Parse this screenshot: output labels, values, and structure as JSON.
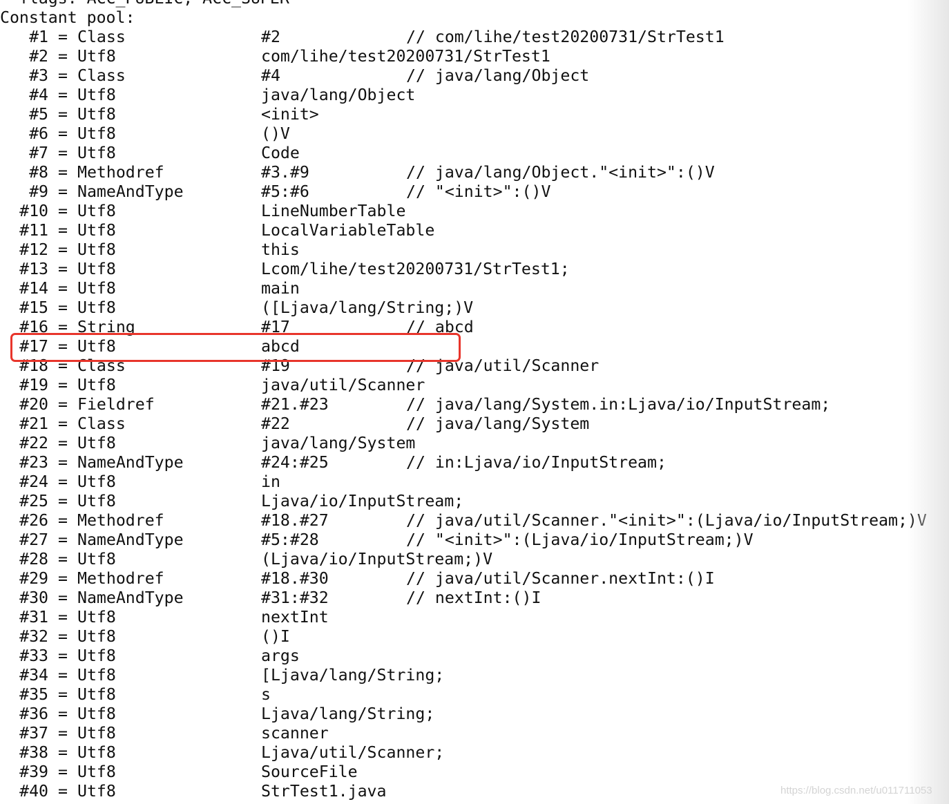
{
  "header_lines": [
    "  flags: ACC_PUBLIC, ACC_SUPER",
    "Constant pool:"
  ],
  "entries": [
    [
      "#1",
      "Class",
      "#2",
      "// com/lihe/test20200731/StrTest1"
    ],
    [
      "#2",
      "Utf8",
      "com/lihe/test20200731/StrTest1",
      ""
    ],
    [
      "#3",
      "Class",
      "#4",
      "// java/lang/Object"
    ],
    [
      "#4",
      "Utf8",
      "java/lang/Object",
      ""
    ],
    [
      "#5",
      "Utf8",
      "<init>",
      ""
    ],
    [
      "#6",
      "Utf8",
      "()V",
      ""
    ],
    [
      "#7",
      "Utf8",
      "Code",
      ""
    ],
    [
      "#8",
      "Methodref",
      "#3.#9",
      "// java/lang/Object.\"<init>\":()V"
    ],
    [
      "#9",
      "NameAndType",
      "#5:#6",
      "// \"<init>\":()V"
    ],
    [
      "#10",
      "Utf8",
      "LineNumberTable",
      ""
    ],
    [
      "#11",
      "Utf8",
      "LocalVariableTable",
      ""
    ],
    [
      "#12",
      "Utf8",
      "this",
      ""
    ],
    [
      "#13",
      "Utf8",
      "Lcom/lihe/test20200731/StrTest1;",
      ""
    ],
    [
      "#14",
      "Utf8",
      "main",
      ""
    ],
    [
      "#15",
      "Utf8",
      "([Ljava/lang/String;)V",
      ""
    ],
    [
      "#16",
      "String",
      "#17",
      "// abcd"
    ],
    [
      "#17",
      "Utf8",
      "abcd",
      ""
    ],
    [
      "#18",
      "Class",
      "#19",
      "// java/util/Scanner"
    ],
    [
      "#19",
      "Utf8",
      "java/util/Scanner",
      ""
    ],
    [
      "#20",
      "Fieldref",
      "#21.#23",
      "// java/lang/System.in:Ljava/io/InputStream;"
    ],
    [
      "#21",
      "Class",
      "#22",
      "// java/lang/System"
    ],
    [
      "#22",
      "Utf8",
      "java/lang/System",
      ""
    ],
    [
      "#23",
      "NameAndType",
      "#24:#25",
      "// in:Ljava/io/InputStream;"
    ],
    [
      "#24",
      "Utf8",
      "in",
      ""
    ],
    [
      "#25",
      "Utf8",
      "Ljava/io/InputStream;",
      ""
    ],
    [
      "#26",
      "Methodref",
      "#18.#27",
      "// java/util/Scanner.\"<init>\":(Ljava/io/InputStream;)V"
    ],
    [
      "#27",
      "NameAndType",
      "#5:#28",
      "// \"<init>\":(Ljava/io/InputStream;)V"
    ],
    [
      "#28",
      "Utf8",
      "(Ljava/io/InputStream;)V",
      ""
    ],
    [
      "#29",
      "Methodref",
      "#18.#30",
      "// java/util/Scanner.nextInt:()I"
    ],
    [
      "#30",
      "NameAndType",
      "#31:#32",
      "// nextInt:()I"
    ],
    [
      "#31",
      "Utf8",
      "nextInt",
      ""
    ],
    [
      "#32",
      "Utf8",
      "()I",
      ""
    ],
    [
      "#33",
      "Utf8",
      "args",
      ""
    ],
    [
      "#34",
      "Utf8",
      "[Ljava/lang/String;",
      ""
    ],
    [
      "#35",
      "Utf8",
      "s",
      ""
    ],
    [
      "#36",
      "Utf8",
      "Ljava/lang/String;",
      ""
    ],
    [
      "#37",
      "Utf8",
      "scanner",
      ""
    ],
    [
      "#38",
      "Utf8",
      "Ljava/util/Scanner;",
      ""
    ],
    [
      "#39",
      "Utf8",
      "SourceFile",
      ""
    ],
    [
      "#40",
      "Utf8",
      "StrTest1.java",
      ""
    ]
  ],
  "highlighted_entry": "#17",
  "highlight_color": "#e8352b",
  "watermark": "https://blog.csdn.net/u011711053"
}
